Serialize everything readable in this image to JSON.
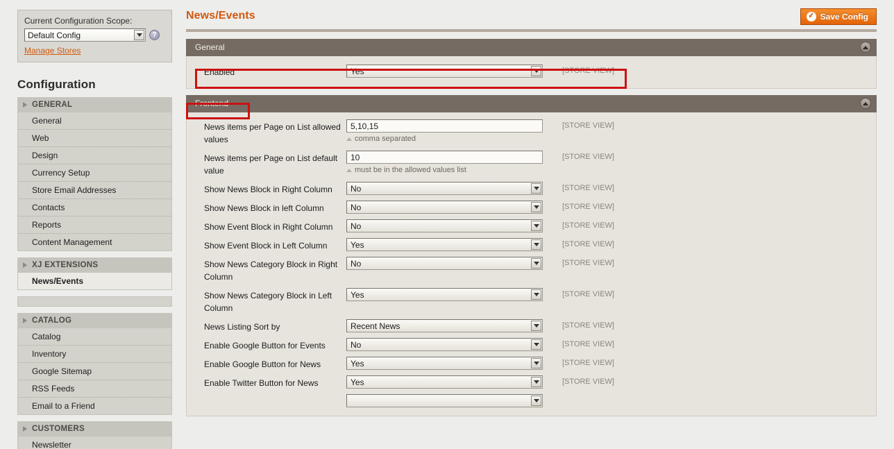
{
  "scope_panel": {
    "label": "Current Configuration Scope:",
    "selected": "Default Config",
    "help_icon": "help-circle-icon",
    "manage_stores_link": "Manage Stores"
  },
  "sidebar": {
    "title": "Configuration",
    "groups": [
      {
        "heading": "GENERAL",
        "items": [
          "General",
          "Web",
          "Design",
          "Currency Setup",
          "Store Email Addresses",
          "Contacts",
          "Reports",
          "Content Management"
        ]
      },
      {
        "heading": "XJ EXTENSIONS",
        "items": [
          "News/Events"
        ],
        "active_item": "News/Events"
      },
      {
        "heading": "CATALOG",
        "items": [
          "Catalog",
          "Inventory",
          "Google Sitemap",
          "RSS Feeds",
          "Email to a Friend"
        ]
      },
      {
        "heading": "CUSTOMERS",
        "items": [
          "Newsletter"
        ]
      }
    ]
  },
  "header": {
    "page_title": "News/Events",
    "save_button": "Save Config",
    "save_icon": "check-circle-icon"
  },
  "sections": [
    {
      "id": "general",
      "title": "General",
      "collapse_icon": "chevron-up-icon",
      "fields": [
        {
          "label": "Enabled",
          "type": "select",
          "value": "Yes",
          "scope": "[STORE VIEW]"
        }
      ]
    },
    {
      "id": "frontend",
      "title": "Frontend",
      "collapse_icon": "chevron-up-icon",
      "fields": [
        {
          "label": "News items per Page on List allowed values",
          "type": "text",
          "value": "5,10,15",
          "hint": "comma separated",
          "scope": "[STORE VIEW]"
        },
        {
          "label": "News items per Page on List default value",
          "type": "text",
          "value": "10",
          "hint": "must be in the allowed values list",
          "scope": "[STORE VIEW]"
        },
        {
          "label": "Show News Block in Right Column",
          "type": "select",
          "value": "No",
          "scope": "[STORE VIEW]"
        },
        {
          "label": "Show News Block in left Column",
          "type": "select",
          "value": "No",
          "scope": "[STORE VIEW]"
        },
        {
          "label": "Show Event Block in Right Column",
          "type": "select",
          "value": "No",
          "scope": "[STORE VIEW]"
        },
        {
          "label": "Show Event Block in Left Column",
          "type": "select",
          "value": "Yes",
          "scope": "[STORE VIEW]"
        },
        {
          "label": "Show News Category Block in Right Column",
          "type": "select",
          "value": "No",
          "scope": "[STORE VIEW]"
        },
        {
          "label": "Show News Category Block in Left Column",
          "type": "select",
          "value": "Yes",
          "scope": "[STORE VIEW]"
        },
        {
          "label": "News Listing Sort by",
          "type": "select",
          "value": "Recent News",
          "scope": "[STORE VIEW]"
        },
        {
          "label": "Enable Google Button for Events",
          "type": "select",
          "value": "No",
          "scope": "[STORE VIEW]"
        },
        {
          "label": "Enable Google Button for News",
          "type": "select",
          "value": "Yes",
          "scope": "[STORE VIEW]"
        },
        {
          "label": "Enable Twitter Button for News",
          "type": "select",
          "value": "Yes",
          "scope": "[STORE VIEW]"
        },
        {
          "label": "",
          "type": "select",
          "value": "",
          "scope": ""
        }
      ]
    }
  ],
  "annotations": {
    "enabled_highlight_color": "#cc1111",
    "frontend_highlight_color": "#cc1111"
  },
  "colors": {
    "accent_orange": "#d1590e",
    "section_header_brown": "#756b63",
    "panel_bg": "#e7e4dd",
    "page_bg": "#ededeb",
    "sidebar_bg": "#d3d2cb"
  }
}
